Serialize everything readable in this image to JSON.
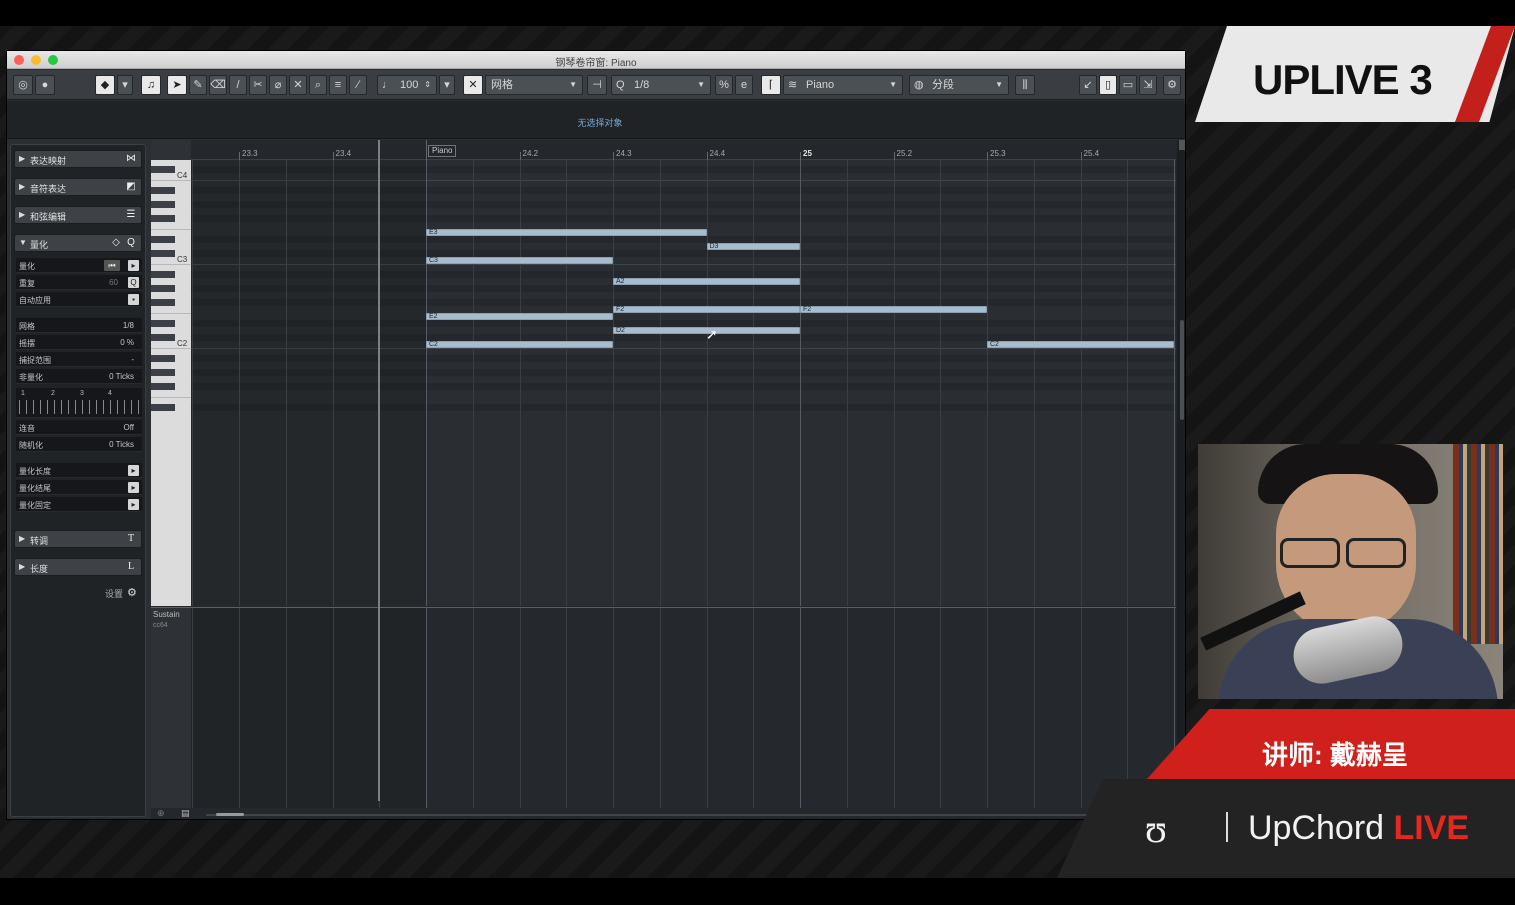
{
  "window": {
    "title": "钢琴卷帘窗: Piano"
  },
  "toolbar": {
    "velocity": "100",
    "snap_mode": "网格",
    "quantize": "1/8",
    "track": "Piano",
    "display_mode": "分段"
  },
  "status_bar": {
    "text": "无选择对象"
  },
  "inspector": {
    "sections": [
      {
        "label": "表达映射",
        "expanded": false
      },
      {
        "label": "音符表达",
        "expanded": false
      },
      {
        "label": "和弦编辑",
        "expanded": false
      },
      {
        "label": "量化",
        "expanded": true
      },
      {
        "label": "转调",
        "expanded": false,
        "icon_text": "T"
      },
      {
        "label": "长度",
        "expanded": false,
        "icon_text": "L"
      }
    ],
    "quantize_rows": [
      {
        "label": "量化"
      },
      {
        "label": "重复",
        "value": "60"
      },
      {
        "label": "自动应用"
      },
      {
        "label": "网格",
        "value": "1/8"
      },
      {
        "label": "摇摆",
        "value": "0 %"
      },
      {
        "label": "捕捉范围",
        "value": "-"
      },
      {
        "label": "非量化",
        "value": "0 Ticks"
      },
      {
        "label": "连音",
        "value": "Off"
      },
      {
        "label": "随机化",
        "value": "0 Ticks"
      },
      {
        "label": "量化长度"
      },
      {
        "label": "量化结尾"
      },
      {
        "label": "量化固定"
      }
    ],
    "swing_marks": [
      "1",
      "2",
      "3",
      "4"
    ],
    "settings_label": "设置"
  },
  "ruler": {
    "labels": [
      "23.3",
      "23.4",
      "24.2",
      "24.3",
      "24.4",
      "25",
      "25.2",
      "25.3",
      "25.4"
    ],
    "clip_name": "Piano"
  },
  "keyboard": {
    "labels": [
      "C4",
      "C3",
      "C2"
    ]
  },
  "notes": [
    {
      "pitch": "E3",
      "start": 24.0,
      "end": 24.75
    },
    {
      "pitch": "D3",
      "start": 24.75,
      "end": 25.0
    },
    {
      "pitch": "C3",
      "start": 24.0,
      "end": 24.5
    },
    {
      "pitch": "A2",
      "start": 24.5,
      "end": 25.0
    },
    {
      "pitch": "F2",
      "start": 24.5,
      "end": 25.0
    },
    {
      "pitch": "F2",
      "start": 25.0,
      "end": 25.5
    },
    {
      "pitch": "E2",
      "start": 24.0,
      "end": 24.5
    },
    {
      "pitch": "D2",
      "start": 24.5,
      "end": 25.0
    },
    {
      "pitch": "C2",
      "start": 24.0,
      "end": 24.5
    },
    {
      "pitch": "C2",
      "start": 25.5,
      "end": 26.0
    }
  ],
  "controller_lane": {
    "name": "Sustain",
    "cc": "cc64"
  },
  "overlay": {
    "event_title": "UPLIVE 3",
    "lecturer": "讲师: 戴赫呈",
    "brand_name": "UpChord",
    "brand_live": "LIVE"
  },
  "colors": {
    "note": "#a7bccd",
    "accent_red": "#d0201b",
    "status_text": "#7aa7d1"
  }
}
